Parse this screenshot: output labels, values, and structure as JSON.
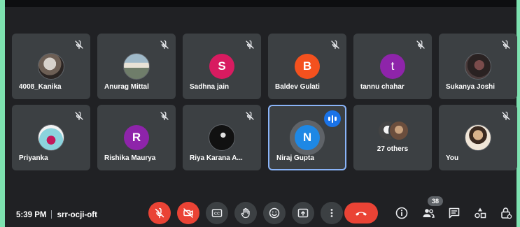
{
  "participants": [
    {
      "name": "4008_Kanika",
      "avatar": "photo",
      "muted": true
    },
    {
      "name": "Anurag Mittal",
      "avatar": "photo",
      "muted": true
    },
    {
      "name": "Sadhna jain",
      "initial": "S",
      "color": "#d81b60",
      "muted": true
    },
    {
      "name": "Baldev Gulati",
      "initial": "B",
      "color": "#f4511e",
      "muted": true
    },
    {
      "name": "tannu chahar",
      "initial": "t",
      "color": "#8e24aa",
      "muted": true
    },
    {
      "name": "Sukanya Joshi",
      "avatar": "photo",
      "muted": true
    },
    {
      "name": "Priyanka",
      "avatar": "photo",
      "muted": true
    },
    {
      "name": "Rishika Maurya",
      "initial": "R",
      "color": "#8e24aa",
      "muted": true
    },
    {
      "name": "Riya Karana A...",
      "avatar": "photo",
      "muted": true
    },
    {
      "name": "Niraj Gupta",
      "initial": "N",
      "color": "#1e88e5",
      "speaking": true
    },
    {
      "others": "27 others"
    },
    {
      "name": "You",
      "avatar": "photo",
      "muted": true
    }
  ],
  "status": {
    "time": "5:39 PM",
    "meeting_code": "srr-ocji-oft"
  },
  "people_count": "38",
  "controls": [
    "mic-off-icon",
    "camera-off-icon",
    "captions-icon",
    "raise-hand-icon",
    "emoji-icon",
    "present-icon",
    "more-icon",
    "end-call-icon"
  ],
  "side_controls": [
    "info-icon",
    "people-icon",
    "chat-icon",
    "activities-icon",
    "host-controls-icon"
  ],
  "colors": {
    "background": "#202124",
    "tile": "#3c4043",
    "danger": "#ea4335",
    "active_border": "#8ab4f8",
    "accent_frame": "#7ee2b0"
  }
}
